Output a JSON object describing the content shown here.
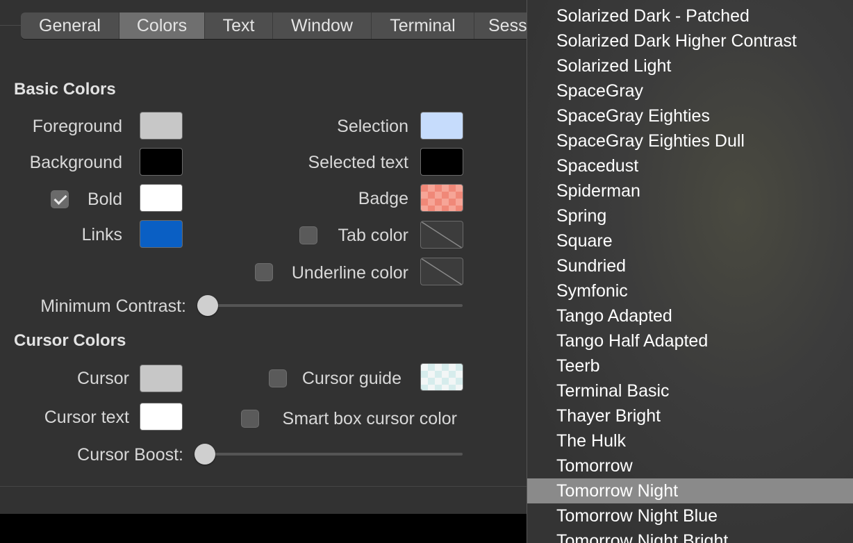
{
  "tabs": [
    "General",
    "Colors",
    "Text",
    "Window",
    "Terminal",
    "Sess"
  ],
  "selected_tab": "Colors",
  "basic_colors": {
    "title": "Basic Colors",
    "foreground": "Foreground",
    "background": "Background",
    "bold": "Bold",
    "links": "Links",
    "selection": "Selection",
    "selected_text": "Selected text",
    "badge": "Badge",
    "tab_color": "Tab color",
    "underline_color": "Underline color",
    "minimum_contrast": "Minimum Contrast:"
  },
  "cursor_colors": {
    "title": "Cursor Colors",
    "cursor": "Cursor",
    "cursor_text": "Cursor text",
    "cursor_guide": "Cursor guide",
    "smart_box": "Smart box cursor color",
    "cursor_boost": "Cursor Boost:"
  },
  "swatches": {
    "foreground": "#c7c7c7",
    "background": "#000000",
    "bold": "#ffffff",
    "links": "#0a5fc4",
    "selection": "#c6dcfc",
    "selected_text": "#000000",
    "cursor": "#c7c7c7",
    "cursor_text": "#ffffff"
  },
  "checkboxes": {
    "bold": true,
    "tab_color": false,
    "underline_color": false,
    "cursor_guide": false,
    "smart_box": false
  },
  "sliders": {
    "minimum_contrast": 0,
    "cursor_boost": 0
  },
  "menu": {
    "items": [
      "Solarized Dark - Patched",
      "Solarized Dark Higher Contrast",
      "Solarized Light",
      "SpaceGray",
      "SpaceGray Eighties",
      "SpaceGray Eighties Dull",
      "Spacedust",
      "Spiderman",
      "Spring",
      "Square",
      "Sundried",
      "Symfonic",
      "Tango Adapted",
      "Tango Half Adapted",
      "Teerb",
      "Terminal Basic",
      "Thayer Bright",
      "The Hulk",
      "Tomorrow",
      "Tomorrow Night",
      "Tomorrow Night Blue",
      "Tomorrow Night Bright"
    ],
    "highlighted": "Tomorrow Night"
  }
}
